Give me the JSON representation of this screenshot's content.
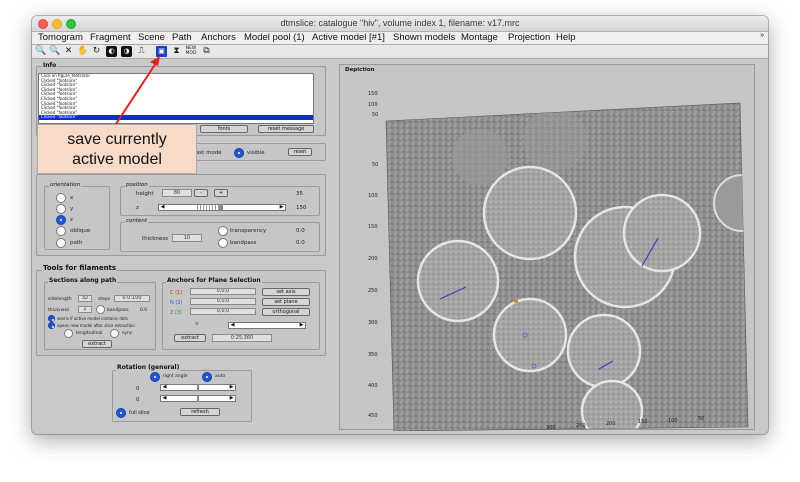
{
  "window": {
    "title": "dtmslice: catalogue \"hiv\", volume index 1, filename: v17.mrc"
  },
  "menu": {
    "items": [
      "Tomogram",
      "Fragment",
      "Scene",
      "Path",
      "Anchors",
      "Model pool (1)",
      "Active model [#1]",
      "Shown models",
      "Montage",
      "Projection",
      "Help"
    ],
    "more": "»"
  },
  "toolbar": {
    "icons": [
      "zoom-in-icon",
      "zoom-out-icon",
      "fit-icon",
      "pan-icon",
      "rotate-icon",
      "contrast-icon",
      "invert-icon",
      "threshold-icon",
      "save-icon",
      "marker-icon",
      "new-model-icon",
      "copy-icon"
    ],
    "new_label": "NEW MOD"
  },
  "info": {
    "title": "Info",
    "lines": [
      "Click on figure_footslicer",
      "Clicked \"footslice\"",
      "Clicked \"footslice\"",
      "Clicked \"footslice\"",
      "Clicked \"footslice\"",
      "Clicked \"footslice\"",
      "Clicked \"footslice\"",
      "Clicked \"footslice\"",
      "Clicked \"footslice\"",
      "Clicked \"footslice\""
    ],
    "fonts_btn": "fonts",
    "reset_btn": "reset message"
  },
  "visibility": {
    "fast_label": "fast mode",
    "visible_label": "visible",
    "reset_btn": "reset"
  },
  "orientation": {
    "title": "orientation",
    "options": [
      "x",
      "y",
      "z",
      "oblique",
      "path"
    ],
    "selected": "z"
  },
  "position": {
    "title": "position",
    "height_label": "height",
    "height_value": "80",
    "minus": "-",
    "plus": "+",
    "value_right": "35",
    "z_label": "z",
    "slider_max": "150"
  },
  "content": {
    "title": "content",
    "thickness_label": "thickness",
    "thickness_value": "10",
    "transparency_label": "transparency",
    "transparency_value": "0.0",
    "bandpass_label": "bandpass",
    "bandpass_value": "0.0"
  },
  "filaments": {
    "title": "Tools for filaments",
    "sections": {
      "title": "Sections along path",
      "sidelength_label": "sidelength",
      "sidelength_value": "32",
      "steps_label": "steps",
      "steps_value": "0.0:100",
      "thickness_label": "thickness",
      "thickness_value": "2",
      "bandpass_label": "bandpass",
      "bandpass_value": "0.0",
      "opt1": "warns if active model contains dots",
      "opt2": "opens new model after slice extraction",
      "longitudinal": "longitudinal",
      "sync": "sync",
      "extract_btn": "extract"
    },
    "anchors": {
      "title": "Anchors for Plane Selection",
      "rows": [
        {
          "label": "C (1)",
          "color": "#d02020",
          "value": "0,0,0",
          "btn": "set axis"
        },
        {
          "label": "N (2)",
          "color": "#2060d0",
          "value": "0,0,0",
          "btn": "set plane"
        },
        {
          "label": "Z (3)",
          "color": "#20a020",
          "value": "0,0,0",
          "btn": "orthogonal"
        }
      ],
      "index_value": "0",
      "extract_btn": "extract",
      "extract_value": "0:25:360"
    }
  },
  "rotation": {
    "title": "Rotation (general)",
    "right_angle": "right angle",
    "auto": "auto",
    "row1_value": "0",
    "row2_value": "0",
    "full_slice": "full slice",
    "refresh_btn": "refresh"
  },
  "depiction": {
    "title": "Depiction",
    "y_ticks": [
      "150",
      "100",
      "50",
      "50",
      "100",
      "150",
      "200",
      "250",
      "300",
      "350",
      "400",
      "450"
    ],
    "x_ticks": [
      "450",
      "400",
      "350",
      "300",
      "250",
      "200",
      "150",
      "100",
      "50"
    ]
  },
  "annotation": {
    "callout_line1": "save currently",
    "callout_line2": "active model",
    "arrow_color": "#e8201c"
  }
}
